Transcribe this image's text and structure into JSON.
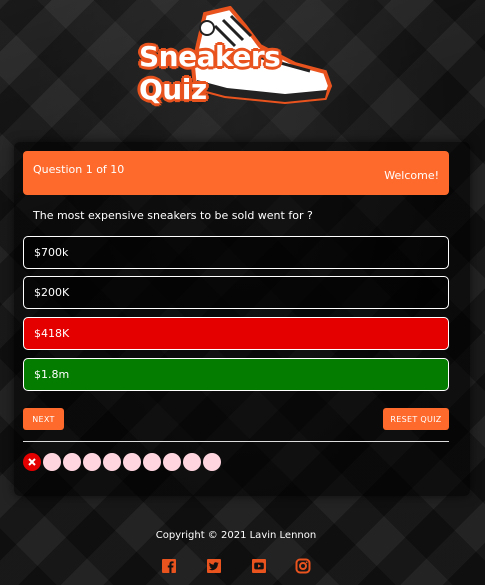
{
  "logo": {
    "text": "Sneakers Quiz",
    "icon": "sneaker-icon",
    "accent": "#e8531e"
  },
  "header": {
    "question_count": "Question 1 of 10",
    "greeting": "Welcome!"
  },
  "question": {
    "text": "The most expensive sneakers to be sold went for ?"
  },
  "answers": [
    {
      "label": "$700k",
      "state": "default"
    },
    {
      "label": "$200K",
      "state": "default"
    },
    {
      "label": "$418K",
      "state": "wrong"
    },
    {
      "label": "$1.8m",
      "state": "correct"
    }
  ],
  "controls": {
    "next_label": "NEXT",
    "reset_label": "RESET QUIZ"
  },
  "progress": {
    "total": 10,
    "states": [
      "wrong",
      "pending",
      "pending",
      "pending",
      "pending",
      "pending",
      "pending",
      "pending",
      "pending",
      "pending"
    ]
  },
  "footer": {
    "copyright": "Copyright © 2021 Lavin Lennon",
    "social": [
      "facebook-icon",
      "twitter-icon",
      "youtube-icon",
      "instagram-icon"
    ]
  },
  "colors": {
    "accent": "#fe6a2c",
    "wrong": "#e50000",
    "correct": "#047c00",
    "pending_dot": "#ffd6e0"
  }
}
